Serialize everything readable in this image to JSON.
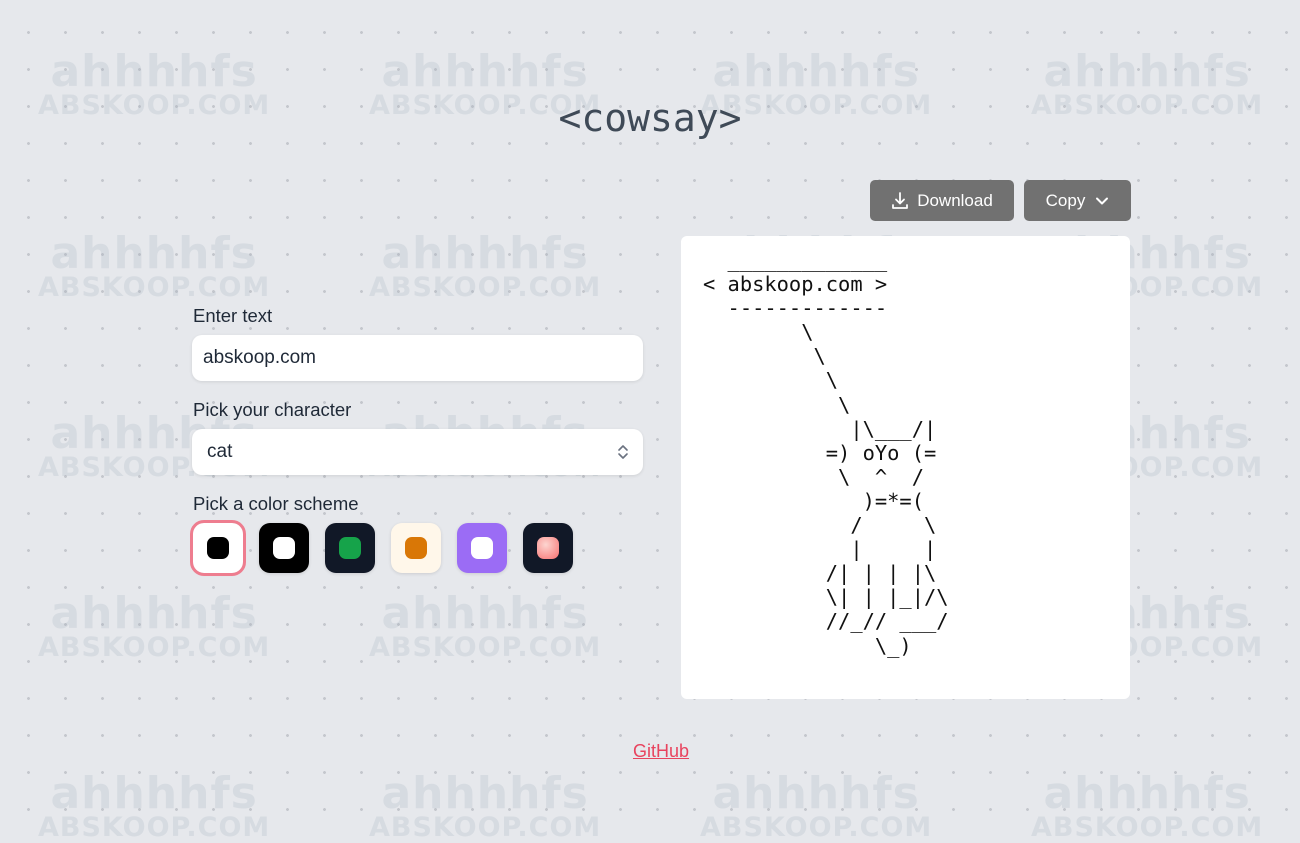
{
  "watermark": {
    "line1": "ahhhhfs",
    "line2": "ABSKOOP.COM"
  },
  "title": "<cowsay>",
  "form": {
    "text_label": "Enter text",
    "text_value": "abskoop.com",
    "character_label": "Pick your character",
    "character_value": "cat",
    "color_label": "Pick a color scheme",
    "color_schemes": [
      {
        "name": "black-on-white",
        "bg": "#ffffff",
        "fg": "#000000",
        "selected": true
      },
      {
        "name": "white-on-black",
        "bg": "#000000",
        "fg": "#ffffff",
        "selected": false
      },
      {
        "name": "green-on-dark",
        "bg": "#111827",
        "fg": "#16a34a",
        "selected": false
      },
      {
        "name": "orange-on-cream",
        "bg": "#fff7ea",
        "fg": "#d97706",
        "selected": false
      },
      {
        "name": "white-on-purple",
        "bg": "#9b6cf5",
        "fg": "#ffffff",
        "selected": false
      },
      {
        "name": "coral-on-dark",
        "bg": "#111827",
        "fg": "#f87171",
        "selected": false
      }
    ]
  },
  "toolbar": {
    "download_label": "Download",
    "download_icon": "download-icon",
    "copy_label": "Copy",
    "copy_icon": "chevron-down-icon"
  },
  "output": {
    "ascii": "  _____________\n< abskoop.com >\n  -------------\n        \\\n         \\\n          \\\n           \\\n            |\\___/|\n          =) oYo (=\n           \\  ^  /\n             )=*=(\n            /     \\\n            |     |\n          /| | | |\\\n          \\| | |_|/\\\n          //_// ___/\n              \\_)"
  },
  "footer": {
    "github_label": "GitHub"
  }
}
